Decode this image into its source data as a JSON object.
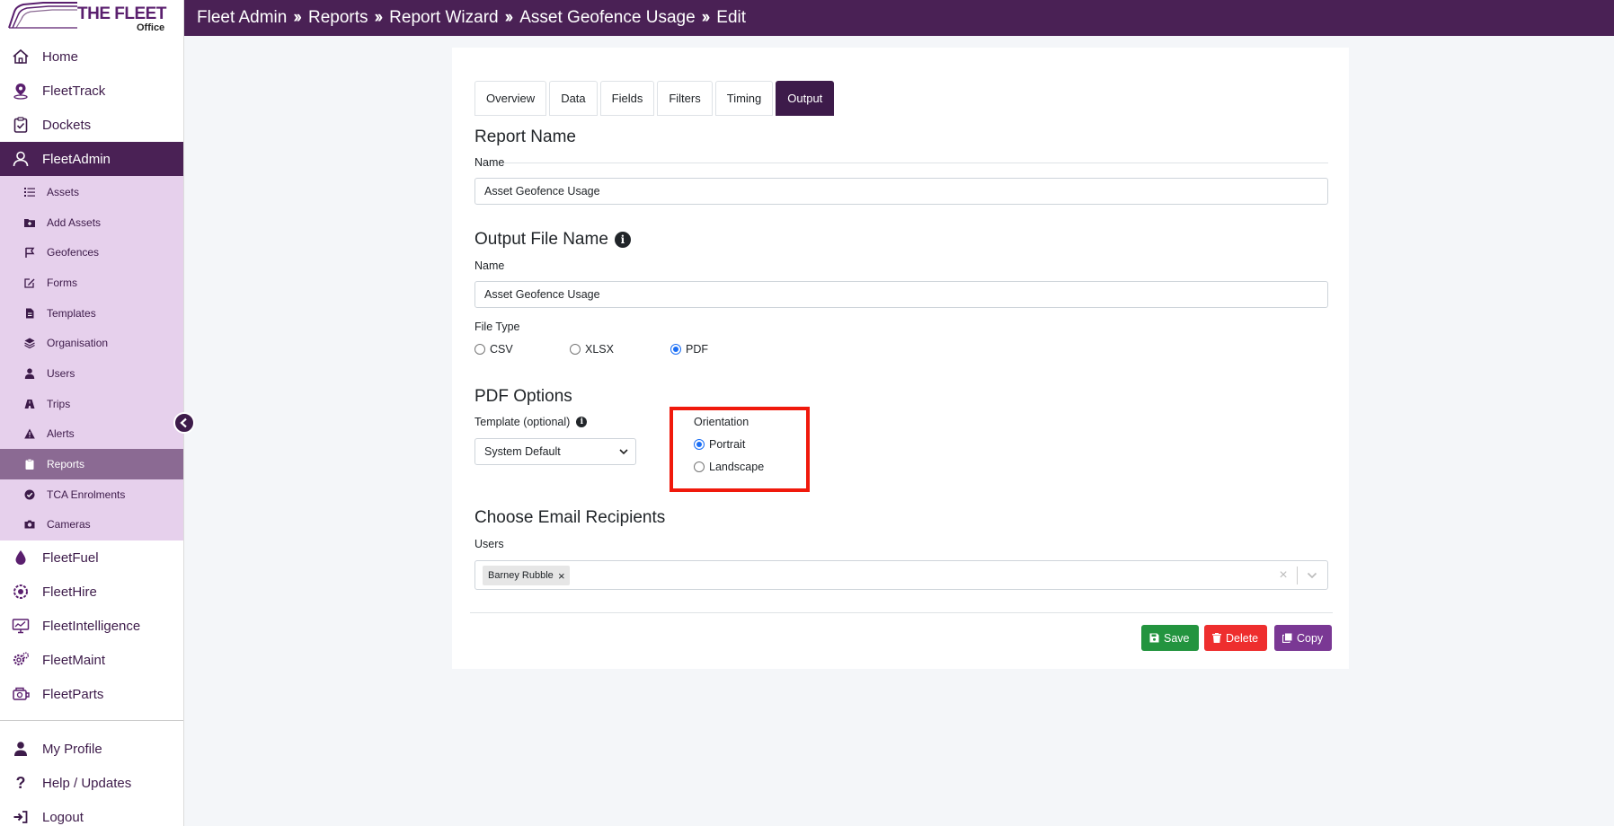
{
  "brand": {
    "name": "THE FLEET",
    "sub": "Office"
  },
  "breadcrumb": [
    "Fleet Admin",
    "Reports",
    "Report Wizard",
    "Asset Geofence Usage",
    "Edit"
  ],
  "sidebar": {
    "top_items": [
      {
        "label": "Home",
        "icon": "home-icon"
      },
      {
        "label": "FleetTrack",
        "icon": "map-pin-icon"
      },
      {
        "label": "Dockets",
        "icon": "clipboard-icon"
      },
      {
        "label": "FleetAdmin",
        "icon": "admin-user-icon",
        "active": true
      }
    ],
    "sub_items": [
      {
        "label": "Assets",
        "icon": "list-icon"
      },
      {
        "label": "Add Assets",
        "icon": "folder-plus-icon"
      },
      {
        "label": "Geofences",
        "icon": "flag-icon"
      },
      {
        "label": "Forms",
        "icon": "edit-icon"
      },
      {
        "label": "Templates",
        "icon": "file-icon"
      },
      {
        "label": "Organisation",
        "icon": "layers-icon"
      },
      {
        "label": "Users",
        "icon": "user-icon"
      },
      {
        "label": "Trips",
        "icon": "road-icon"
      },
      {
        "label": "Alerts",
        "icon": "warning-icon"
      },
      {
        "label": "Reports",
        "icon": "clipboard-list-icon",
        "active": true
      },
      {
        "label": "TCA Enrolments",
        "icon": "check-circle-icon"
      },
      {
        "label": "Cameras",
        "icon": "camera-icon"
      }
    ],
    "module_items": [
      {
        "label": "FleetFuel",
        "icon": "fuel-drop-icon"
      },
      {
        "label": "FleetHire",
        "icon": "hire-icon"
      },
      {
        "label": "FleetIntelligence",
        "icon": "monitor-chart-icon"
      },
      {
        "label": "FleetMaint",
        "icon": "gears-icon"
      },
      {
        "label": "FleetParts",
        "icon": "parts-icon"
      }
    ],
    "bottom_items": [
      {
        "label": "My Profile",
        "icon": "profile-icon"
      },
      {
        "label": "Help / Updates",
        "icon": "question-icon"
      },
      {
        "label": "Logout",
        "icon": "logout-icon"
      }
    ]
  },
  "tabs": [
    "Overview",
    "Data",
    "Fields",
    "Filters",
    "Timing",
    "Output"
  ],
  "active_tab": "Output",
  "report_name": {
    "title": "Report Name",
    "label": "Name",
    "value": "Asset Geofence Usage"
  },
  "output_file": {
    "title": "Output File Name",
    "label": "Name",
    "value": "Asset Geofence Usage"
  },
  "file_type": {
    "label": "File Type",
    "options": [
      "CSV",
      "XLSX",
      "PDF"
    ],
    "selected": "PDF"
  },
  "pdf_options": {
    "title": "PDF Options",
    "template_label": "Template (optional)",
    "template_value": "System Default",
    "orientation_label": "Orientation",
    "orientation_options": [
      "Portrait",
      "Landscape"
    ],
    "orientation_selected": "Portrait"
  },
  "email": {
    "title": "Choose Email Recipients",
    "label": "Users",
    "selected_users": [
      "Barney Rubble"
    ]
  },
  "buttons": {
    "save": "Save",
    "delete": "Delete",
    "copy": "Copy"
  },
  "colors": {
    "primary": "#4a2155",
    "submenu_bg": "#e6d0ec",
    "save": "#23943f",
    "delete": "#ee2e2e",
    "copy": "#7a3894",
    "highlight": "#f0190c"
  }
}
